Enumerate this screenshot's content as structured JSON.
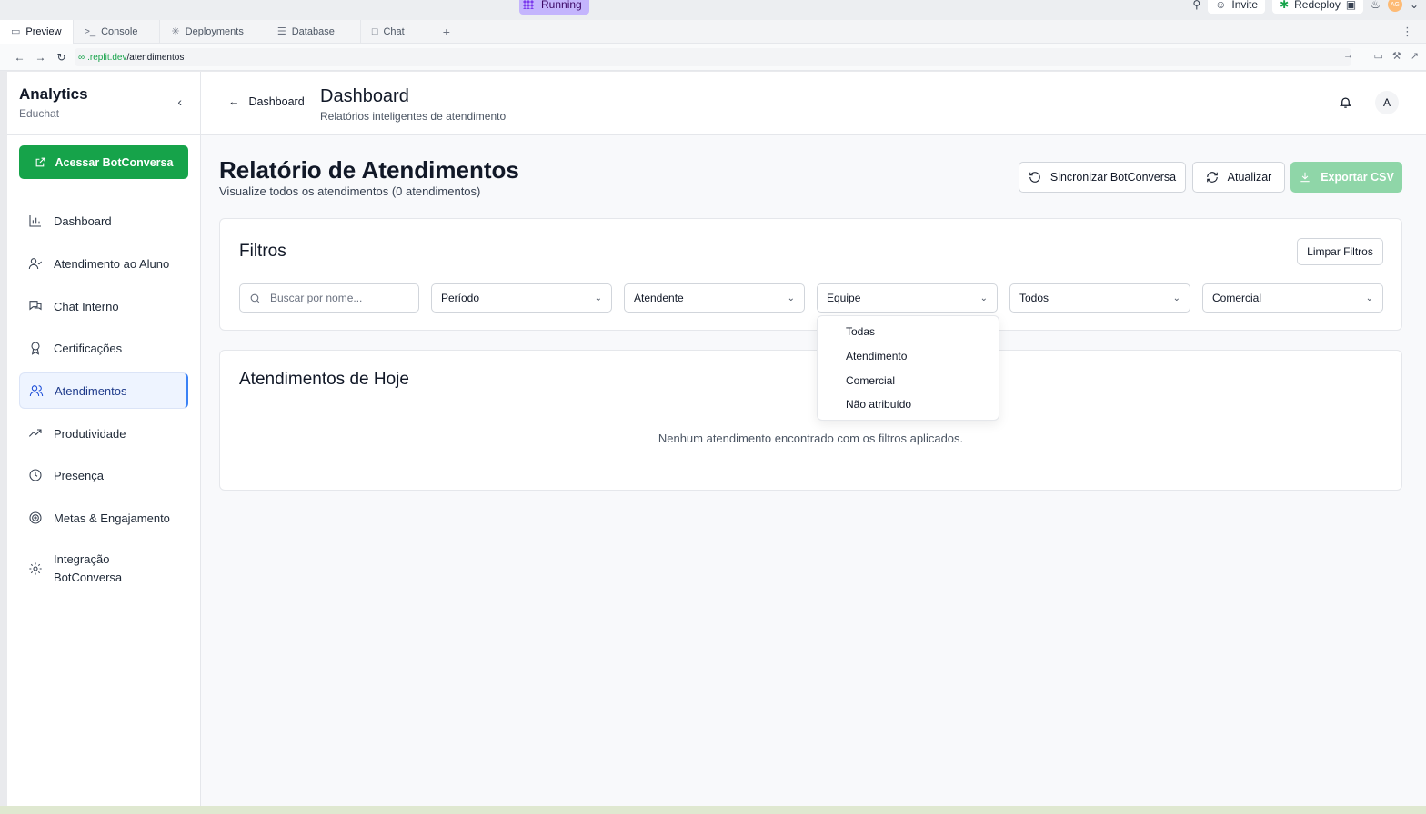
{
  "system": {
    "running_label": "Running",
    "invite_label": "Invite",
    "redeploy_label": "Redeploy",
    "user_initials": "AG"
  },
  "tabs": [
    {
      "label": "Preview",
      "icon": "monitor-icon"
    },
    {
      "label": "Console",
      "icon": "terminal-icon"
    },
    {
      "label": "Deployments",
      "icon": "deploy-icon"
    },
    {
      "label": "Database",
      "icon": "database-icon"
    },
    {
      "label": "Chat",
      "icon": "chat-icon"
    }
  ],
  "browser": {
    "url_domain": ".replit.dev",
    "url_path": "/atendimentos"
  },
  "sidebar": {
    "title": "Analytics",
    "subtitle": "Educhat",
    "cta_label": "Acessar BotConversa",
    "items": [
      {
        "label": "Dashboard",
        "icon": "bar-chart-icon"
      },
      {
        "label": "Atendimento ao Aluno",
        "icon": "user-check-icon"
      },
      {
        "label": "Chat Interno",
        "icon": "messages-icon"
      },
      {
        "label": "Certificações",
        "icon": "award-icon"
      },
      {
        "label": "Atendimentos",
        "icon": "users-icon"
      },
      {
        "label": "Produtividade",
        "icon": "trending-up-icon"
      },
      {
        "label": "Presença",
        "icon": "clock-icon"
      },
      {
        "label": "Metas & Engajamento",
        "icon": "target-icon"
      },
      {
        "label": "Integração",
        "label2": "BotConversa",
        "icon": "settings-icon"
      }
    ],
    "active_index": 4
  },
  "header": {
    "back_label": "Dashboard",
    "title": "Dashboard",
    "subtitle": "Relatórios inteligentes de atendimento",
    "avatar_initial": "A"
  },
  "page": {
    "title": "Relatório de Atendimentos",
    "subtitle": "Visualize todos os atendimentos (0 atendimentos)",
    "sync_label": "Sincronizar BotConversa",
    "refresh_label": "Atualizar",
    "export_label": "Exportar CSV"
  },
  "filters": {
    "title": "Filtros",
    "clear_label": "Limpar Filtros",
    "search_placeholder": "Buscar por nome...",
    "periodo": "Período",
    "atendente": "Atendente",
    "equipe": "Equipe",
    "status": "Todos",
    "setor": "Comercial",
    "equipe_options": [
      "Todas",
      "Atendimento",
      "Comercial",
      "Não atribuído"
    ]
  },
  "today": {
    "title": "Atendimentos de Hoje",
    "empty_message": "Nenhum atendimento encontrado com os filtros aplicados."
  },
  "colors": {
    "primary_green": "#16a34a",
    "export_disabled": "#8fd6a8",
    "active_nav_bg": "#eef4ff",
    "running_badge": "#c4b5fd"
  }
}
